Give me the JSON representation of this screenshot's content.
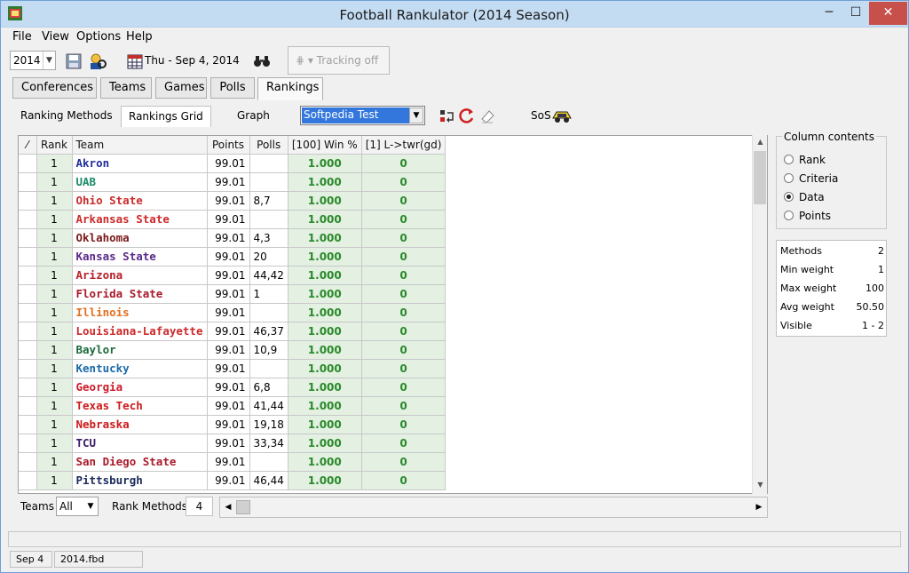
{
  "window": {
    "title": "Football Rankulator  (2014 Season)",
    "minimize": "─",
    "maximize": "☐",
    "close": "✕"
  },
  "menu": [
    "File",
    "View",
    "Options",
    "Help"
  ],
  "toolbar": {
    "year": "2014",
    "date": "Thu - Sep 4, 2014",
    "tracking": "Tracking off",
    "tracking_glyph": "⋕ ▾"
  },
  "tabs": [
    "Conferences",
    "Teams",
    "Games",
    "Polls",
    "Rankings"
  ],
  "subtabs": [
    "Ranking Methods",
    "Rankings Grid",
    "Graph"
  ],
  "method_select": "Softpedia Test",
  "sos_label": "SoS",
  "grid": {
    "headers": [
      "⁄",
      "Rank",
      "Team",
      "Points",
      "Polls",
      "[100] Win %",
      "[1] L->twr(gd)"
    ],
    "rows": [
      {
        "rank": "1",
        "team": "Akron",
        "color": "#1f2f9a",
        "points": "99.01",
        "polls": "",
        "win": "1.000",
        "ltwr": "0"
      },
      {
        "rank": "1",
        "team": "UAB",
        "color": "#1a8a6a",
        "points": "99.01",
        "polls": "",
        "win": "1.000",
        "ltwr": "0"
      },
      {
        "rank": "1",
        "team": "Ohio State",
        "color": "#cc2a2a",
        "points": "99.01",
        "polls": "8,7",
        "win": "1.000",
        "ltwr": "0"
      },
      {
        "rank": "1",
        "team": "Arkansas State",
        "color": "#cc2a2a",
        "points": "99.01",
        "polls": "",
        "win": "1.000",
        "ltwr": "0"
      },
      {
        "rank": "1",
        "team": "Oklahoma",
        "color": "#7a1a1a",
        "points": "99.01",
        "polls": "4,3",
        "win": "1.000",
        "ltwr": "0"
      },
      {
        "rank": "1",
        "team": "Kansas State",
        "color": "#5a2a8a",
        "points": "99.01",
        "polls": "20",
        "win": "1.000",
        "ltwr": "0"
      },
      {
        "rank": "1",
        "team": "Arizona",
        "color": "#b8202a",
        "points": "99.01",
        "polls": "44,42",
        "win": "1.000",
        "ltwr": "0"
      },
      {
        "rank": "1",
        "team": "Florida State",
        "color": "#aa1a2a",
        "points": "99.01",
        "polls": "1",
        "win": "1.000",
        "ltwr": "0"
      },
      {
        "rank": "1",
        "team": "Illinois",
        "color": "#e07020",
        "points": "99.01",
        "polls": "",
        "win": "1.000",
        "ltwr": "0"
      },
      {
        "rank": "1",
        "team": "Louisiana-Lafayette",
        "color": "#cc2a2a",
        "points": "99.01",
        "polls": "46,37",
        "win": "1.000",
        "ltwr": "0"
      },
      {
        "rank": "1",
        "team": "Baylor",
        "color": "#1a6a3a",
        "points": "99.01",
        "polls": "10,9",
        "win": "1.000",
        "ltwr": "0"
      },
      {
        "rank": "1",
        "team": "Kentucky",
        "color": "#1a6aa8",
        "points": "99.01",
        "polls": "",
        "win": "1.000",
        "ltwr": "0"
      },
      {
        "rank": "1",
        "team": "Georgia",
        "color": "#cc1a2a",
        "points": "99.01",
        "polls": "6,8",
        "win": "1.000",
        "ltwr": "0"
      },
      {
        "rank": "1",
        "team": "Texas Tech",
        "color": "#cc1a1a",
        "points": "99.01",
        "polls": "41,44",
        "win": "1.000",
        "ltwr": "0"
      },
      {
        "rank": "1",
        "team": "Nebraska",
        "color": "#cc1a1a",
        "points": "99.01",
        "polls": "19,18",
        "win": "1.000",
        "ltwr": "0"
      },
      {
        "rank": "1",
        "team": "TCU",
        "color": "#3a1a6a",
        "points": "99.01",
        "polls": "33,34",
        "win": "1.000",
        "ltwr": "0"
      },
      {
        "rank": "1",
        "team": "San Diego State",
        "color": "#aa1a2a",
        "points": "99.01",
        "polls": "",
        "win": "1.000",
        "ltwr": "0"
      },
      {
        "rank": "1",
        "team": "Pittsburgh",
        "color": "#1a2a5a",
        "points": "99.01",
        "polls": "46,44",
        "win": "1.000",
        "ltwr": "0"
      }
    ]
  },
  "column_contents": {
    "legend": "Column contents",
    "options": [
      "Rank",
      "Criteria",
      "Data",
      "Points"
    ],
    "selected": "Data"
  },
  "stats": [
    {
      "label": "Methods",
      "value": "2"
    },
    {
      "label": "Min weight",
      "value": "1"
    },
    {
      "label": "Max weight",
      "value": "100"
    },
    {
      "label": "Avg weight",
      "value": "50.50"
    },
    {
      "label": "Visible",
      "value": "1 - 2"
    }
  ],
  "bottom": {
    "teams_label": "Teams",
    "teams_value": "All",
    "rank_methods_label": "Rank Methods",
    "rank_methods_value": "4"
  },
  "status": {
    "date": "Sep 4",
    "file": "2014.fbd"
  }
}
